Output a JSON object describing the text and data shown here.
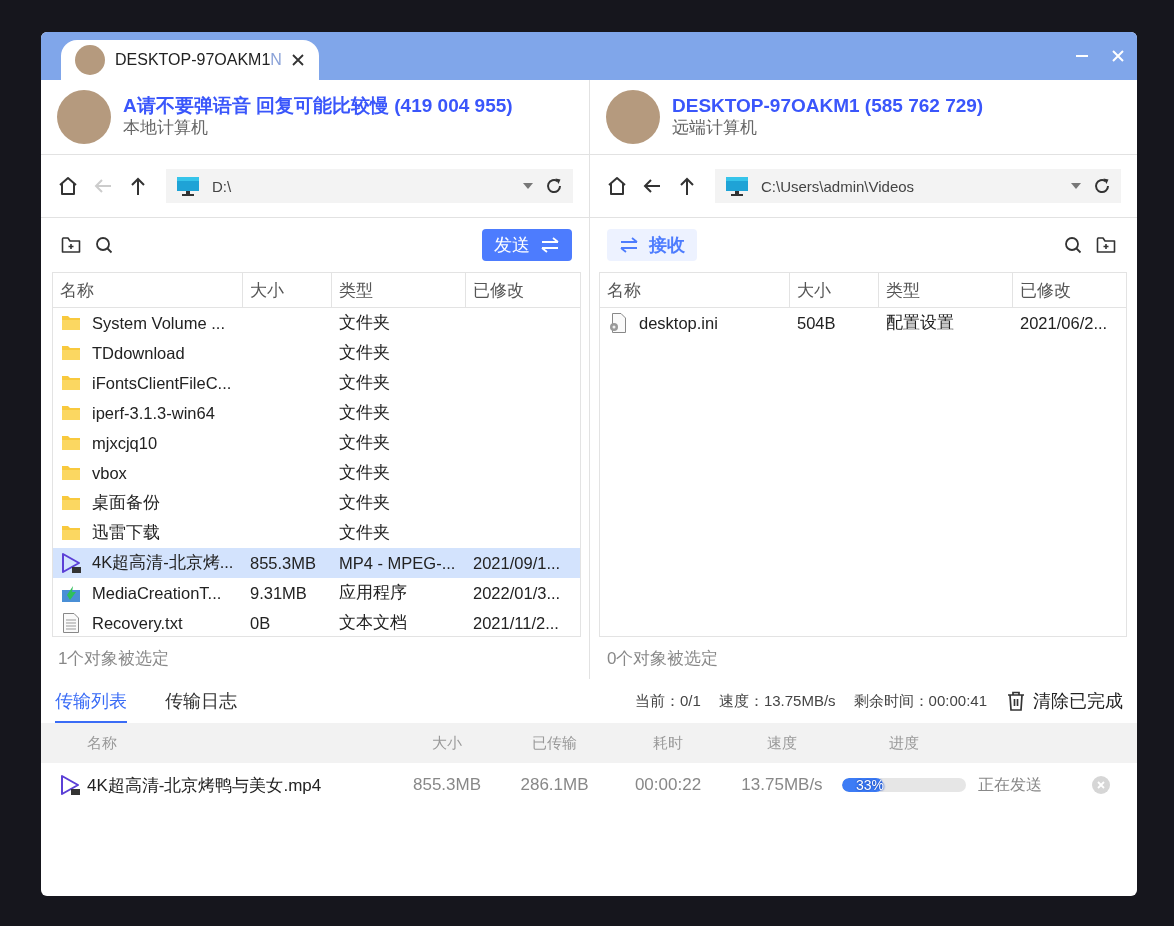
{
  "tab": {
    "title": "DESKTOP-97OAKM1",
    "title_fade": "N"
  },
  "panes": [
    {
      "kind": "local",
      "name": "A请不要弹语音 回复可能比较慢 (419 004 955)",
      "role": "本地计算机",
      "back_disabled": true,
      "path": "D:\\",
      "action": {
        "kind": "send",
        "label": "发送"
      },
      "columns": [
        "名称",
        "大小",
        "类型",
        "已修改"
      ],
      "rows": [
        {
          "kind": "folder",
          "name": "System Volume ...",
          "size": "",
          "type": "文件夹",
          "modified": "",
          "selected": false
        },
        {
          "kind": "folder",
          "name": "TDdownload",
          "size": "",
          "type": "文件夹",
          "modified": "",
          "selected": false
        },
        {
          "kind": "folder",
          "name": "iFontsClientFileC...",
          "size": "",
          "type": "文件夹",
          "modified": "",
          "selected": false
        },
        {
          "kind": "folder",
          "name": "iperf-3.1.3-win64",
          "size": "",
          "type": "文件夹",
          "modified": "",
          "selected": false
        },
        {
          "kind": "folder",
          "name": "mjxcjq10",
          "size": "",
          "type": "文件夹",
          "modified": "",
          "selected": false
        },
        {
          "kind": "folder",
          "name": "vbox",
          "size": "",
          "type": "文件夹",
          "modified": "",
          "selected": false
        },
        {
          "kind": "folder",
          "name": "桌面备份",
          "size": "",
          "type": "文件夹",
          "modified": "",
          "selected": false
        },
        {
          "kind": "folder",
          "name": "迅雷下载",
          "size": "",
          "type": "文件夹",
          "modified": "",
          "selected": false
        },
        {
          "kind": "video",
          "name": "4K超高清-北京烤...",
          "size": "855.3MB",
          "type": "MP4 - MPEG-...",
          "modified": "2021/09/1...",
          "selected": true
        },
        {
          "kind": "app",
          "name": "MediaCreationT...",
          "size": "9.31MB",
          "type": "应用程序",
          "modified": "2022/01/3...",
          "selected": false
        },
        {
          "kind": "text",
          "name": "Recovery.txt",
          "size": "0B",
          "type": "文本文档",
          "modified": "2021/11/2...",
          "selected": false
        }
      ],
      "status": "1个对象被选定"
    },
    {
      "kind": "remote",
      "name": "DESKTOP-97OAKM1 (585 762 729)",
      "role": "远端计算机",
      "back_disabled": false,
      "path": "C:\\Users\\admin\\Videos",
      "action": {
        "kind": "receive",
        "label": "接收"
      },
      "columns": [
        "名称",
        "大小",
        "类型",
        "已修改"
      ],
      "rows": [
        {
          "kind": "config",
          "name": "desktop.ini",
          "size": "504B",
          "type": "配置设置",
          "modified": "2021/06/2...",
          "selected": false
        }
      ],
      "status": "0个对象被选定"
    }
  ],
  "transfer": {
    "tabs": [
      {
        "label": "传输列表",
        "selected": true
      },
      {
        "label": "传输日志",
        "selected": false
      }
    ],
    "stats": [
      "当前：0/1",
      "速度：13.75MB/s",
      "剩余时间：00:00:41"
    ],
    "clear_label": "清除已完成",
    "columns": [
      "名称",
      "大小",
      "已传输",
      "耗时",
      "速度",
      "进度"
    ],
    "rows": [
      {
        "kind": "video",
        "name": "4K超高清-北京烤鸭与美女.mp4",
        "size": "855.3MB",
        "transferred": "286.1MB",
        "elapsed": "00:00:22",
        "speed": "13.75MB/s",
        "level": 0.33,
        "percent": "33%",
        "status": "正在发送"
      }
    ]
  }
}
